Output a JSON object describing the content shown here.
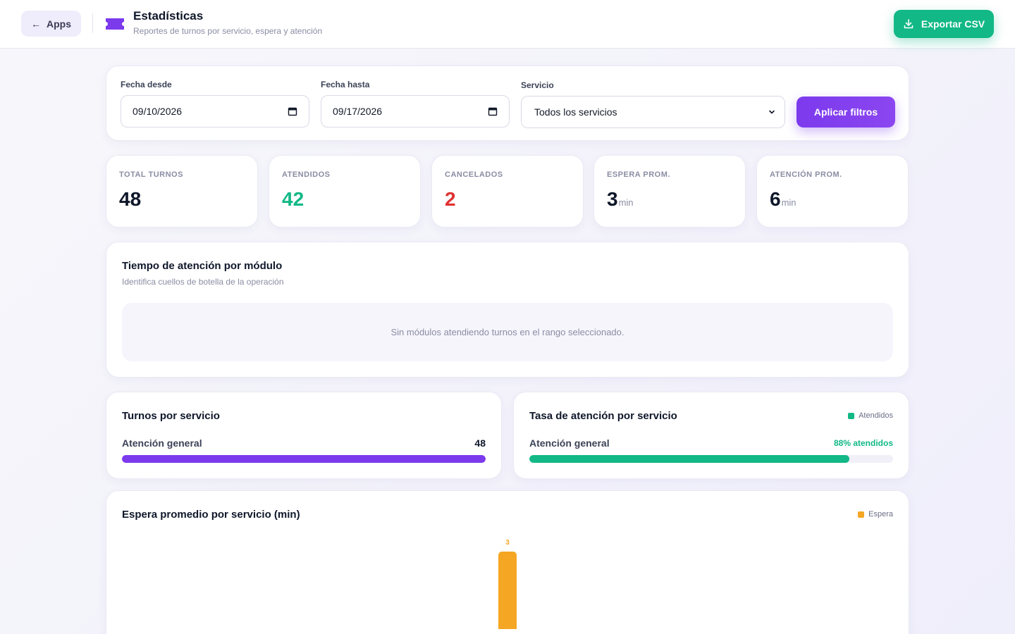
{
  "header": {
    "back_label": "Apps",
    "title": "Estadísticas",
    "subtitle": "Reportes de turnos por servicio, espera y atención",
    "export_label": "Exportar CSV"
  },
  "filters": {
    "from_label": "Fecha desde",
    "from_value": "09/10/2026",
    "to_label": "Fecha hasta",
    "to_value": "09/17/2026",
    "service_label": "Servicio",
    "service_value": "Todos los servicios",
    "apply_label": "Aplicar filtros"
  },
  "stats": [
    {
      "label": "TOTAL TURNOS",
      "value": "48",
      "unit": "",
      "color": "#0f172a"
    },
    {
      "label": "ATENDIDOS",
      "value": "42",
      "unit": "",
      "color": "#12b886"
    },
    {
      "label": "CANCELADOS",
      "value": "2",
      "unit": "",
      "color": "#e03131"
    },
    {
      "label": "ESPERA PROM.",
      "value": "3",
      "unit": "min",
      "color": "#0f172a"
    },
    {
      "label": "ATENCIÓN PROM.",
      "value": "6",
      "unit": "min",
      "color": "#0f172a"
    }
  ],
  "modules": {
    "title": "Tiempo de atención por módulo",
    "subtitle": "Identifica cuellos de botella de la operación",
    "empty": "Sin módulos atendiendo turnos en el rango seleccionado."
  },
  "per_service": {
    "title": "Turnos por servicio",
    "rows": [
      {
        "name": "Atención general",
        "value": "48",
        "fraction": 1.0
      }
    ]
  },
  "rate": {
    "title": "Tasa de atención por servicio",
    "legend": "Atendidos",
    "rows": [
      {
        "name": "Atención general",
        "value": "88% atendidos",
        "fraction": 0.88
      }
    ]
  },
  "wait": {
    "title": "Espera promedio por servicio (min)",
    "legend": "Espera"
  },
  "colors": {
    "accent": "#7c3aed",
    "success": "#12b886",
    "danger": "#e03131",
    "warning": "#f5a623"
  },
  "chart_data": {
    "type": "bar",
    "title": "Espera promedio por servicio (min)",
    "categories": [
      ""
    ],
    "series": [
      {
        "name": "Espera",
        "values": [
          3
        ]
      }
    ],
    "ylim": [
      0,
      3
    ]
  }
}
